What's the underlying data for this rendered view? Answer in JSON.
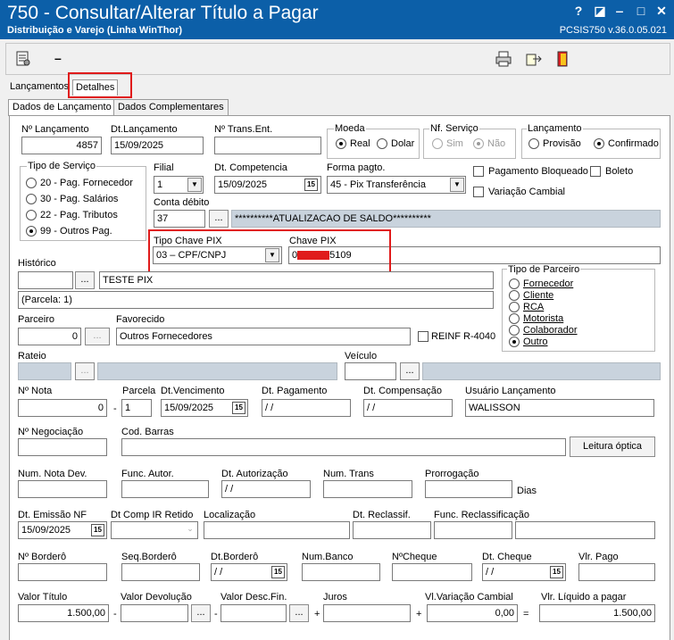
{
  "window": {
    "title": "750 - Consultar/Alterar Título a Pagar",
    "subtitle": "Distribuição e Varejo (Linha WinThor)",
    "version": "PCSIS750  v.36.0.05.021"
  },
  "tabs": [
    "Lançamentos",
    "Detalhes"
  ],
  "subtabs": [
    "Dados de Lançamento",
    "Dados Complementares"
  ],
  "form": {
    "n_lancamento": {
      "label": "Nº Lançamento",
      "value": "4857"
    },
    "dt_lancamento": {
      "label": "Dt.Lançamento",
      "value": "15/09/2025"
    },
    "n_trans_ent": {
      "label": "Nº Trans.Ent.",
      "value": ""
    },
    "moeda": {
      "label": "Moeda",
      "options": [
        "Real",
        "Dolar"
      ],
      "selected": "Real"
    },
    "nf_servico": {
      "label": "Nf. Serviço",
      "options": [
        "Sim",
        "Não"
      ],
      "selected": "Não"
    },
    "lancamento": {
      "label": "Lançamento",
      "options": [
        "Provisão",
        "Confirmado"
      ],
      "selected": "Confirmado"
    },
    "tipo_servico": {
      "label": "Tipo de Serviço",
      "options": [
        "20 - Pag. Fornecedor",
        "30 - Pag. Salários",
        "22 - Pag. Tributos",
        "99 - Outros Pag."
      ],
      "selected": "99 - Outros Pag."
    },
    "filial": {
      "label": "Filial",
      "value": "1"
    },
    "dt_competencia": {
      "label": "Dt. Competencia",
      "value": "15/09/2025"
    },
    "forma_pagto": {
      "label": "Forma pagto.",
      "value": "45 - Pix Transferência"
    },
    "pagamento_bloqueado": "Pagamento Bloqueado",
    "boleto": "Boleto",
    "variacao_cambial": "Variação Cambial",
    "conta_debito": {
      "label": "Conta débito",
      "value": "37",
      "description": "**********ATUALIZACAO DE SALDO**********"
    },
    "tipo_chave_pix": {
      "label": "Tipo Chave PIX",
      "value": "03 – CPF/CNPJ"
    },
    "chave_pix": {
      "label": "Chave PIX",
      "value_start": "0",
      "value_end": "5109"
    },
    "historico": {
      "label": "Histórico",
      "text1": "TESTE PIX",
      "text2": "(Parcela: 1)"
    },
    "tipo_parceiro": {
      "label": "Tipo de Parceiro",
      "options": [
        "Fornecedor",
        "Cliente",
        "RCA",
        "Motorista",
        "Colaborador",
        "Outro"
      ],
      "selected": "Outro"
    },
    "parceiro": {
      "label": "Parceiro",
      "value": "0"
    },
    "favorecido": {
      "label": "Favorecido",
      "value": "Outros Fornecedores"
    },
    "reinf": "REINF R-4040",
    "rateio": "Rateio",
    "veiculo": "Veículo",
    "n_nota": {
      "label": "Nº Nota",
      "value": "0"
    },
    "parcela": {
      "label": "Parcela",
      "value": "1"
    },
    "dt_vencimento": {
      "label": "Dt.Vencimento",
      "value": "15/09/2025"
    },
    "dt_pagamento": {
      "label": "Dt. Pagamento",
      "value": " / /"
    },
    "dt_compensacao": {
      "label": "Dt. Compensação",
      "value": " / /"
    },
    "usuario_lancamento": {
      "label": "Usuário Lançamento",
      "value": "WALISSON"
    },
    "n_negociacao": "Nº Negociação",
    "cod_barras": "Cod. Barras",
    "leitura_optica": "Leitura óptica",
    "num_nota_dev": "Num. Nota Dev.",
    "func_autor": "Func. Autor.",
    "dt_autorizacao": {
      "label": "Dt. Autorização",
      "value": " / /"
    },
    "num_trans": "Num. Trans",
    "prorrogacao": "Prorrogação",
    "dias": "Dias",
    "dt_emissao_nf": {
      "label": "Dt. Emissão NF",
      "value": "15/09/2025"
    },
    "dt_comp_ir": "Dt Comp IR Retido",
    "localizacao": "Localização",
    "dt_reclassif": "Dt. Reclassif.",
    "func_reclassificacao": "Func. Reclassificação",
    "n_bordero": "Nº Borderô",
    "seq_bordero": "Seq.Borderô",
    "dt_bordero": {
      "label": "Dt.Borderô",
      "value": " / /"
    },
    "num_banco": "Num.Banco",
    "n_cheque": "NºCheque",
    "dt_cheque": {
      "label": "Dt. Cheque",
      "value": " / /"
    },
    "vlr_pago": "Vlr. Pago",
    "valor_titulo": {
      "label": "Valor Título",
      "value": "1.500,00"
    },
    "valor_devolucao": "Valor Devolução",
    "valor_desc_fin": "Valor Desc.Fin.",
    "juros": "Juros",
    "vl_variacao_cambial": {
      "label": "Vl.Variação Cambial",
      "value": "0,00"
    },
    "vlr_liquido": {
      "label": "Vlr. Líquido a pagar",
      "value": "1.500,00"
    },
    "dash": "-",
    "plus": "+",
    "equals": "=",
    "ellipsis": "..."
  },
  "colors": {
    "titlebar": "#0c5fa8",
    "highlight": "#e01b1b",
    "gray_field": "#c9d3dd"
  }
}
